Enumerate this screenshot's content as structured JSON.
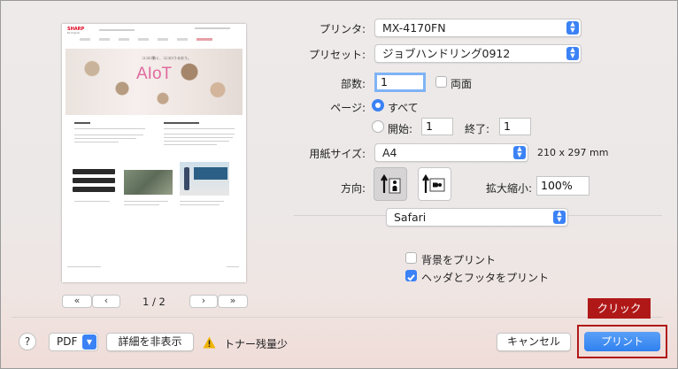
{
  "print": {
    "printer_label": "プリンタ:",
    "printer_value": "MX-4170FN",
    "preset_label": "プリセット:",
    "preset_value": "ジョブハンドリング0912",
    "copies_label": "部数:",
    "copies_value": "1",
    "two_sided_label": "両面",
    "pages_label": "ページ:",
    "all_label": "すべて",
    "from_label": "開始:",
    "from_value": "1",
    "to_label": "終了:",
    "to_value": "1",
    "paper_label": "用紙サイズ:",
    "paper_value": "A4",
    "paper_dims": "210 x 297 mm",
    "orientation_label": "方向:",
    "scale_label": "拡大縮小:",
    "scale_value": "100%",
    "app_section": "Safari",
    "bg_print_label": "背景をプリント",
    "header_footer_label": "ヘッダとフッタをプリント",
    "header_footer_checked": true
  },
  "preview": {
    "page_indicator": "1 / 2",
    "first_label": "«",
    "prev_label": "‹",
    "next_label": "›",
    "last_label": "»",
    "logo": "SHARP",
    "logo_sub": "Be Original.",
    "hero_text": "AIoT",
    "hero_caption": "ココロ動く、ココロうるおう。"
  },
  "bottom": {
    "help_label": "?",
    "pdf_label": "PDF",
    "details_label": "詳細を非表示",
    "warning_text": "トナー残量少",
    "cancel_label": "キャンセル",
    "print_label": "プリント"
  },
  "annotation": {
    "callout_text": "クリック",
    "color": "#b01818"
  },
  "colors": {
    "accent": "#3b82f6",
    "print_button": "#2f80f0",
    "warning": "#f0b400"
  }
}
